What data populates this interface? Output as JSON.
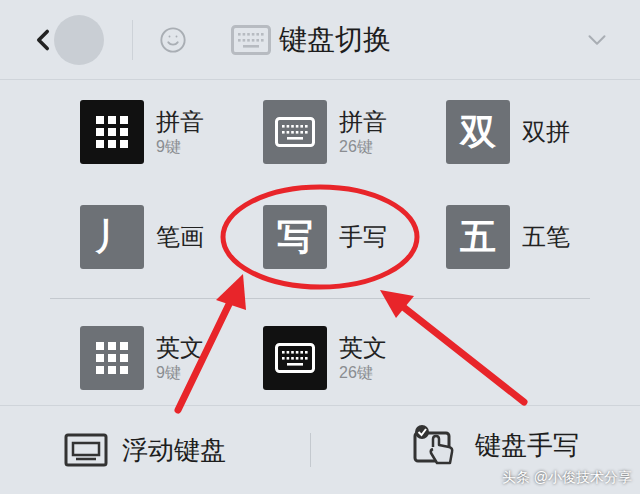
{
  "header": {
    "title": "键盘切换"
  },
  "sections": [
    [
      {
        "label": "拼音",
        "sub": "9键",
        "kind": "grid",
        "selected": true,
        "circled": false
      },
      {
        "label": "拼音",
        "sub": "26键",
        "kind": "keyboard",
        "selected": false,
        "circled": false
      },
      {
        "label": "双拼",
        "kind": "glyph",
        "glyph": "双",
        "selected": false,
        "circled": false
      },
      {
        "label": "笔画",
        "kind": "glyph",
        "glyph": "丿",
        "selected": false,
        "circled": false
      },
      {
        "label": "手写",
        "kind": "glyph",
        "glyph": "写",
        "selected": false,
        "circled": true
      },
      {
        "label": "五笔",
        "kind": "glyph",
        "glyph": "五",
        "selected": false,
        "circled": false
      }
    ],
    [
      {
        "label": "英文",
        "sub": "9键",
        "kind": "grid",
        "selected": false,
        "circled": false
      },
      {
        "label": "英文",
        "sub": "26键",
        "kind": "keyboard",
        "selected": true,
        "circled": false
      }
    ]
  ],
  "footer": [
    {
      "label": "浮动键盘",
      "kind": "float"
    },
    {
      "label": "键盘手写",
      "kind": "handwrite"
    }
  ],
  "watermark": "头条 @小俊技术分享"
}
